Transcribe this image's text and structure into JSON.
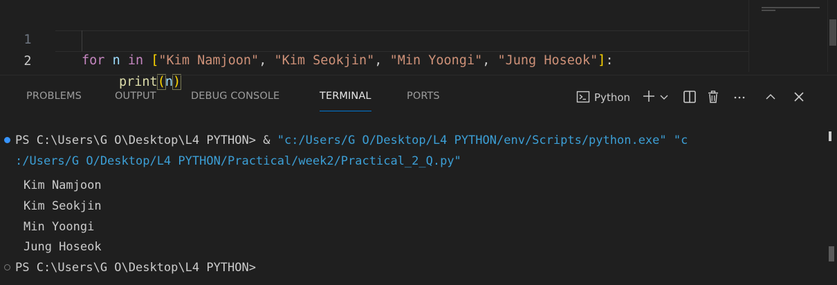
{
  "editor": {
    "lines": [
      {
        "number": "1",
        "tokens": {
          "kw_for": "for",
          "var_n": "n",
          "kw_in": "in",
          "open": "[",
          "s1": "\"Kim Namjoon\"",
          "c1": ", ",
          "s2": "\"Kim Seokjin\"",
          "c2": ", ",
          "s3": "\"Min Yoongi\"",
          "c3": ", ",
          "s4": "\"Jung Hoseok\"",
          "close": "]",
          "colon": ":"
        }
      },
      {
        "number": "2",
        "tokens": {
          "fn": "print",
          "open": "(",
          "arg": "n",
          "close": ")"
        }
      }
    ]
  },
  "panel": {
    "tabs": [
      "PROBLEMS",
      "OUTPUT",
      "DEBUG CONSOLE",
      "TERMINAL",
      "PORTS"
    ],
    "active_tab": "TERMINAL",
    "terminal_profile": "Python",
    "icons": {
      "profile": "terminal-icon",
      "new": "plus-icon",
      "dropdown": "chevron-down-icon",
      "split": "split-icon",
      "kill": "trash-icon",
      "more": "more-icon",
      "maximize": "chevron-up-icon",
      "close": "close-icon"
    }
  },
  "terminal": {
    "prompt1": "PS C:\\Users\\G O\\Desktop\\L4 PYTHON> ",
    "cmd_amp": "& ",
    "cmd_part1": "\"c:/Users/G O/Desktop/L4 PYTHON/env/Scripts/python.exe\" \"c",
    "cmd_part2": ":/Users/G O/Desktop/L4 PYTHON/Practical/week2/Practical_2_Q.py\"",
    "output": [
      "Kim Namjoon",
      "Kim Seokjin",
      "Min Yoongi",
      "Jung Hoseok"
    ],
    "prompt2": "PS C:\\Users\\G O\\Desktop\\L4 PYTHON>",
    "colors": {
      "success_dot": "#3794ff",
      "string": "#3c9fd6"
    }
  }
}
